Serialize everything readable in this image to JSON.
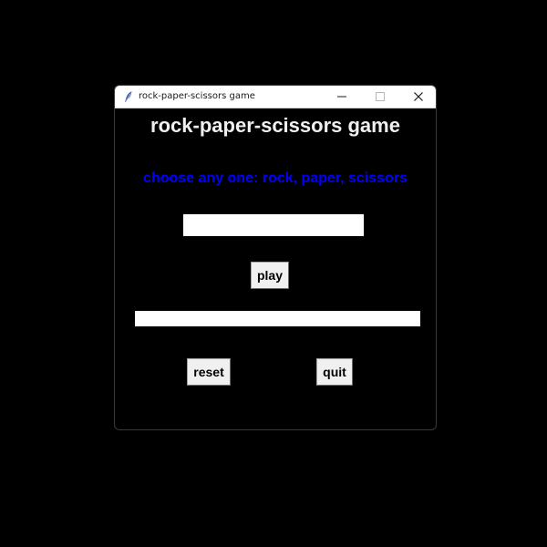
{
  "window": {
    "title": "rock-paper-scissors game",
    "icon": "feather-icon"
  },
  "titlebar_buttons": {
    "minimize_icon": "minimize-icon",
    "maximize_icon": "maximize-icon",
    "close_icon": "close-icon"
  },
  "main": {
    "heading": "rock-paper-scissors game",
    "prompt": "choose any one: rock, paper, scissors",
    "choice_input_value": "",
    "play_label": "play",
    "result_text": "",
    "reset_label": "reset",
    "quit_label": "quit"
  },
  "colors": {
    "background": "#000000",
    "heading": "#f0f0f0",
    "prompt": "#0000ff",
    "button_face": "#f0f0f0",
    "field": "#ffffff"
  }
}
